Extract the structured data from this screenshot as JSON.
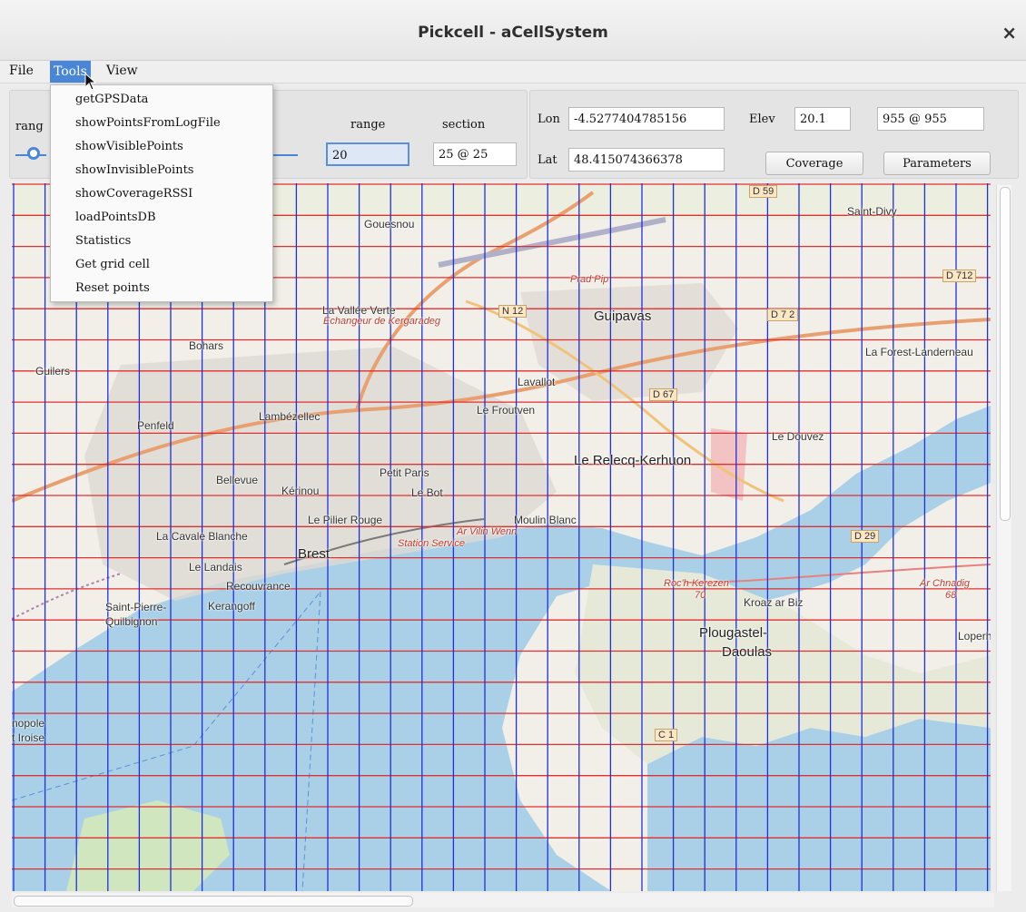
{
  "window": {
    "title": "Pickcell - aCellSystem",
    "close_glyph": "×"
  },
  "menu": {
    "file": "File",
    "tools": "Tools",
    "view": "View"
  },
  "tools_menu": [
    "getGPSData",
    "showPointsFromLogFile",
    "showVisiblePoints",
    "showInvisiblePoints",
    "showCoverageRSSI",
    "loadPointsDB",
    "Statistics",
    "Get grid cell",
    "Reset points"
  ],
  "controls": {
    "range_label_left": "rang",
    "range_label": "range",
    "range_value": "20",
    "section_label": "section",
    "section_value": "25 @ 25",
    "lon_label": "Lon",
    "lon_value": "-4.5277404785156",
    "lat_label": "Lat",
    "lat_value": "48.415074366378",
    "elev_label": "Elev",
    "elev_value": "20.1",
    "cell_value": "955 @ 955",
    "coverage_button": "Coverage",
    "parameters_button": "Parameters"
  },
  "map": {
    "labels": {
      "d59": "D 59",
      "saint_divy": "Saint-Divy",
      "gouesnou": "Gouesnou",
      "d712a": "D 712",
      "prad_pip": "Prad Pip",
      "la_vallee": "La Vallée Verte",
      "echangeur": "Echangeur de Kergaradeg",
      "n12": "N 12",
      "guipavas": "Guipavas",
      "d712b": "D 7 2",
      "bohars": "Bohars",
      "la_forest": "La Forest-Landerneau",
      "guilers": "Guilers",
      "lavallot": "Lavallot",
      "d67": "D 67",
      "le_froutven": "Le Froutven",
      "penfeld": "Penfeld",
      "lambezellec": "Lambézellec",
      "le_douvez": "Le Douvez",
      "le_relecq": "Le Relecq-Kerhuon",
      "bellevue": "Bellevue",
      "petit_paris": "Petit Paris",
      "kerinou": "Kérinou",
      "le_bot": "Le Bot",
      "le_pilier": "Le Pilier Rouge",
      "moulin_blanc": "Moulin Blanc",
      "ar_vilin": "Ar Vilin Wenn",
      "la_cavale": "La Cavale Blanche",
      "station": "Station Service",
      "brest": "Brest",
      "d29": "D 29",
      "le_landais": "Le Landais",
      "recouvrance": "Recouvrance",
      "roch_kerezen": "Roc'h Kerezen",
      "ar_chnadig": "Ar Chnadig",
      "n70": "70",
      "kroaz": "Kroaz ar Biz",
      "n68": "68",
      "saint_pierre": "Saint-Pierre-",
      "quilbignon": "Quilbignon",
      "kerangoff": "Kerangoff",
      "plougastel": "Plougastel-",
      "daoulas": "Daoulas",
      "loperhet": "Loperh",
      "technopole": "nopole",
      "iroise": "t Iroise",
      "c1": "C 1"
    },
    "colors": {
      "land": "#f1efe8",
      "water": "#a9d0e6",
      "grid_h": "#e03030",
      "grid_v": "#2030e0",
      "green": "#cfe6bf"
    }
  },
  "colors": {
    "accent": "#4a86d8"
  }
}
